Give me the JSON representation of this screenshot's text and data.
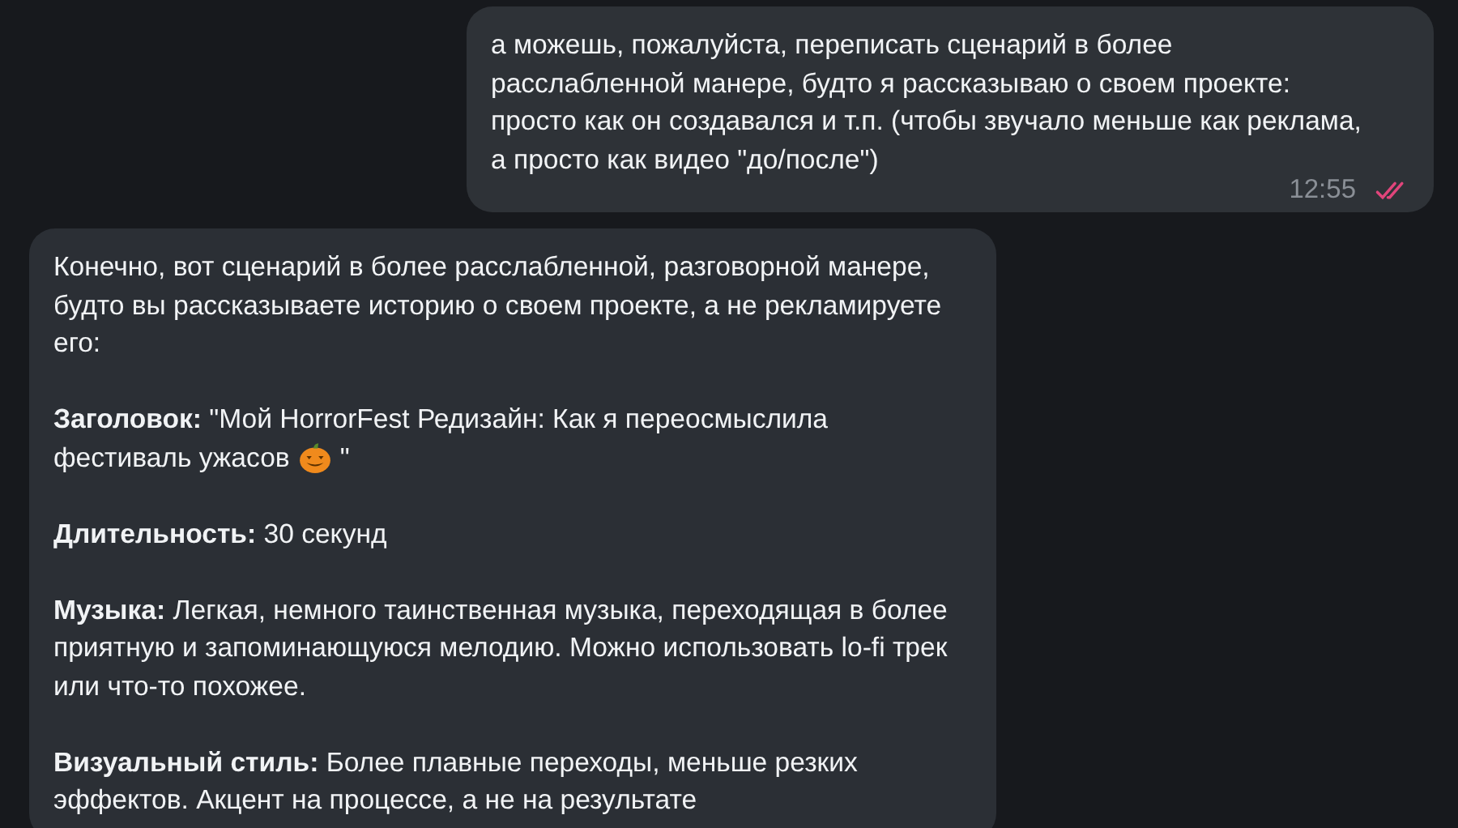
{
  "messages": [
    {
      "kind": "outgoing",
      "paragraphs": [
        {
          "kind": "text",
          "text": "а можешь, пожалуйста, переписать сценарий в более расслабленной манере, будто я рассказываю о своем проекте: просто как он создавался и т.п. (чтобы звучало меньше как реклама, а просто как видео \"до/после\")"
        }
      ],
      "time": "12:55",
      "read": true
    },
    {
      "kind": "incoming",
      "paragraphs": [
        {
          "kind": "text",
          "text": "Конечно, вот сценарий в более расслабленной, разговорной манере, будто вы рассказываете историю о своем проекте, а не рекламируете его:"
        },
        {
          "kind": "pumpkin",
          "text": "**Заголовок:** \"Мой HorrorFest Редизайн: Как я переосмыслила",
          "tail": "фестиваль ужасов",
          "after": "\""
        },
        {
          "kind": "text",
          "text": "**Длительность:** 30 секунд"
        },
        {
          "kind": "text",
          "text": "**Музыка:** Легкая, немного таинственная музыка, переходящая в более приятную и запоминающуюся мелодию. Можно использовать lo-fi трек или что-то похожее."
        },
        {
          "kind": "text",
          "text": "**Визуальный стиль:** Более плавные переходы, меньше резких эффектов. Акцент на процессе, а не на результате"
        }
      ]
    }
  ]
}
